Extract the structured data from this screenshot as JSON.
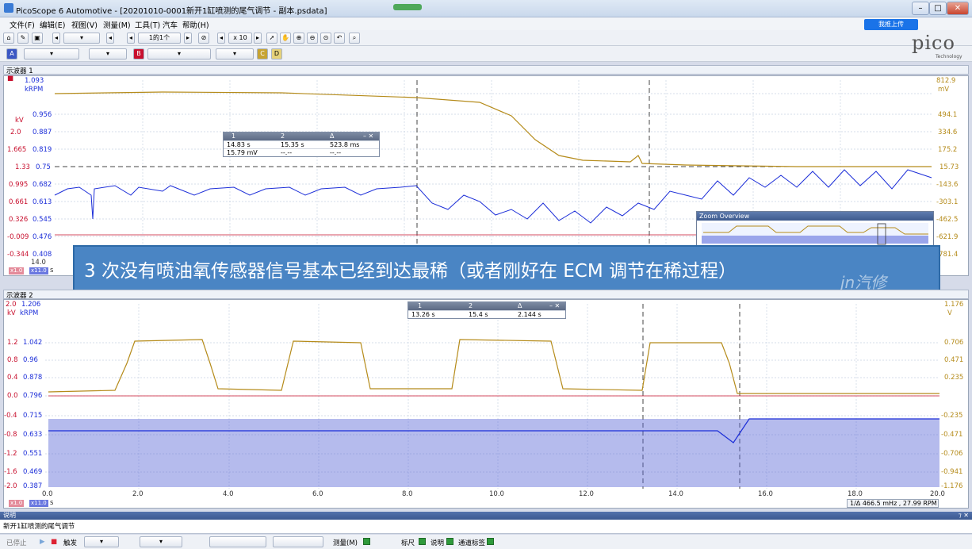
{
  "window": {
    "title": "PicoScope 6 Automotive - [20201010-0001新开1缸喷测的尾气调节 - 副本.psdata]"
  },
  "menu": [
    "文件(F)",
    "编辑(E)",
    "视图(V)",
    "测量(M)",
    "工具(T)",
    "汽车",
    "帮助(H)"
  ],
  "cloud_label": "我推上传",
  "toolbar": {
    "page_counter": "1的1个",
    "zoom": "x 10"
  },
  "channels": {
    "a": "A",
    "b": "B",
    "c": "C",
    "d": "D"
  },
  "logo": {
    "text": "pico",
    "sub": "Technology"
  },
  "scope1": {
    "title": "示波器 1",
    "kv_label": "kV",
    "krpm_label": "kRPM",
    "red_ticks": [
      "1.665",
      "1.33",
      "0.995",
      "0.661",
      "0.326",
      "-0.009",
      "-0.344"
    ],
    "red_top": "2.0",
    "blue_ticks": [
      "1.093",
      "0.956",
      "0.887",
      "0.819",
      "0.75",
      "0.682",
      "0.613",
      "0.545",
      "0.476",
      "0.408"
    ],
    "gold_ticks": [
      "812.9",
      "494.1",
      "334.6",
      "175.2",
      "15.73",
      "-143.6",
      "-303.1",
      "-462.5",
      "-621.9",
      "-781.4"
    ],
    "gold_unit": "mV",
    "x_start": "14.0",
    "badges": [
      "x1.0",
      "x11.0",
      "s"
    ]
  },
  "table1": {
    "cols": [
      "1",
      "2",
      "Δ"
    ],
    "rows": [
      [
        "14.83 s",
        "15.35 s",
        "523.8 ms"
      ],
      [
        "15.79 mV",
        "--.--",
        "--.--"
      ]
    ]
  },
  "zoom_overview": {
    "title": "Zoom Overview"
  },
  "banner": "3 次没有喷油氧传感器信号基本已经到达最稀（或者刚好在 ECM 调节在稀过程）",
  "scope2": {
    "title": "示波器 2",
    "kv_label": "kV",
    "krpm_label": "kRPM",
    "red_ticks": [
      "2.0",
      "1.2",
      "0.8",
      "0.4",
      "0.0",
      "-0.4",
      "-0.8",
      "-1.2",
      "-1.6",
      "-2.0"
    ],
    "blue_ticks": [
      "1.206",
      "1.042",
      "0.96",
      "0.878",
      "0.796",
      "0.715",
      "0.633",
      "0.551",
      "0.469",
      "0.387"
    ],
    "gold_ticks": [
      "1.176",
      "0.706",
      "0.471",
      "0.235",
      "-0.235",
      "-0.471",
      "-0.706",
      "-0.941",
      "-1.176"
    ],
    "gold_unit": "V",
    "x_ticks": [
      "0.0",
      "2.0",
      "4.0",
      "6.0",
      "8.0",
      "10.0",
      "12.0",
      "14.0",
      "16.0",
      "18.0",
      "20.0"
    ],
    "badges": [
      "x1.0",
      "x11.0",
      "s"
    ],
    "readout": "466.5 mHz , 27.99 RPM",
    "readout_prefix": "1/Δ"
  },
  "table2": {
    "cols": [
      "1",
      "2",
      "Δ"
    ],
    "rows": [
      [
        "13.26 s",
        "15.4 s",
        "2.144 s"
      ]
    ]
  },
  "description": {
    "header": "说明",
    "text": "新开1缸喷测的尾气调节"
  },
  "status": {
    "stopped": "已停止",
    "trigger": "触发",
    "measure": "测量(M)",
    "ruler": "标尺",
    "note": "说明",
    "channel_labels": "通道标签"
  },
  "watermark": "jn汽修"
}
